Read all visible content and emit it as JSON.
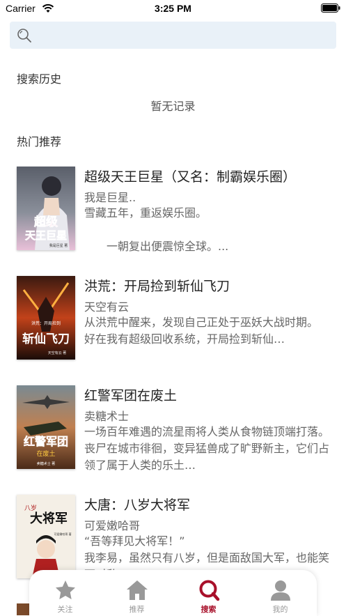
{
  "status_bar": {
    "carrier": "Carrier",
    "time": "3:25 PM"
  },
  "search": {
    "placeholder": ""
  },
  "history": {
    "title": "搜索历史",
    "empty_text": "暂无记录"
  },
  "hot": {
    "title": "热门推荐"
  },
  "books": [
    {
      "title": "超级天王巨星（又名：制霸娱乐圈）",
      "author": "我是巨星..",
      "description": "雪藏五年，重返娱乐圈。\n\n　　一朝复出便震惊全球。...",
      "cover_title": "超级天王巨星",
      "cover_author": "我是巨星 著"
    },
    {
      "title": "洪荒：开局捡到斩仙飞刀",
      "author": "天空有云",
      "description": "从洪荒中醒来，发现自己正处于巫妖大战时期。\n好在我有超级回收系统，开局捡到斩仙…",
      "cover_title": "斩仙飞刀",
      "cover_subtitle": "洪荒：开局捡到",
      "cover_author": "天空有云 著"
    },
    {
      "title": "红警军团在废土",
      "author": "卖糖术士",
      "description": "一场百年难遇的流星雨将人类从食物链顶端打落。丧尸在城市徘徊，变异猛兽成了旷野新主，它们占领了属于人类的乐土…",
      "cover_title": "红警军团",
      "cover_subtitle": "在废土",
      "cover_author": "卖糖术士 著"
    },
    {
      "title": "大唐：八岁大将军",
      "author": "可爱嫩哈哥",
      "description": "“吾等拜见大将军！”\n我李易，虽然只有八岁，但是面敌国大军，也能笑面对敌",
      "cover_title": "大将军",
      "cover_subtitle": "八岁",
      "cover_author": "可爱嫩哈哥 著"
    }
  ],
  "tabs": [
    {
      "label": "关注",
      "icon": "star-icon"
    },
    {
      "label": "推荐",
      "icon": "home-icon"
    },
    {
      "label": "搜索",
      "icon": "search-icon",
      "active": true
    },
    {
      "label": "我的",
      "icon": "person-icon"
    }
  ],
  "colors": {
    "accent": "#a8102a",
    "search_bg": "#e9f1f8",
    "tab_inactive": "#999999"
  }
}
